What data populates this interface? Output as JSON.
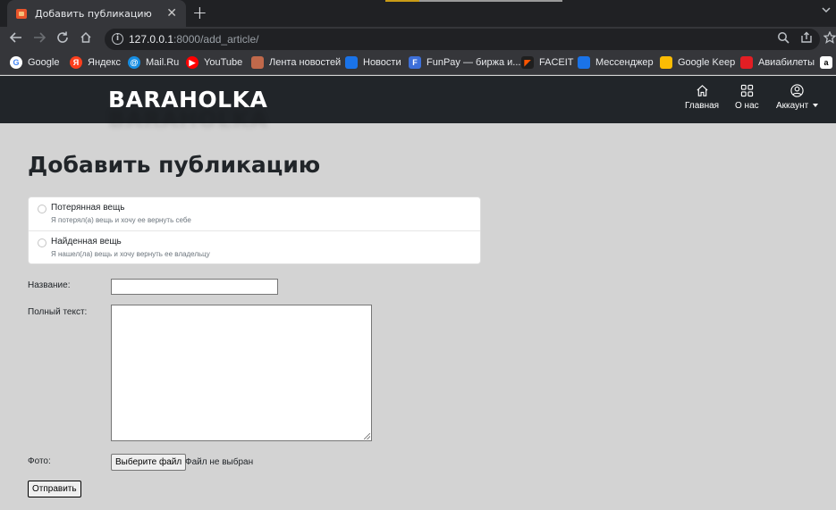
{
  "browser": {
    "tab": {
      "title": "Добавить публикацию",
      "close_glyph": "✕"
    },
    "new_tab_glyph": "+",
    "url": {
      "host": "127.0.0.1",
      "path": ":8000/add_article/"
    },
    "bookmarks": [
      {
        "label": "Google",
        "icon": "google-icon",
        "color": "#4285f4"
      },
      {
        "label": "Яндекс",
        "icon": "yandex-icon",
        "color": "#fc3f1d"
      },
      {
        "label": "Mail.Ru",
        "icon": "mailru-icon",
        "color": "#168de2"
      },
      {
        "label": "YouTube",
        "icon": "youtube-icon",
        "color": "#ff0000"
      },
      {
        "label": "Лента новостей",
        "icon": "news-feed-icon",
        "color": "#c0694b"
      },
      {
        "label": "Новости",
        "icon": "news-icon",
        "color": "#1a73e8"
      },
      {
        "label": "FunPay — биржа и...",
        "icon": "funpay-icon",
        "color": "#3d6fd8"
      },
      {
        "label": "FACEIT",
        "icon": "faceit-icon",
        "color": "#ff5500"
      },
      {
        "label": "Мессенджер",
        "icon": "messenger-icon",
        "color": "#1a73e8"
      },
      {
        "label": "Google Keep",
        "icon": "keep-icon",
        "color": "#fbbc04"
      },
      {
        "label": "Авиабилеты",
        "icon": "avia-icon",
        "color": "#e31e24"
      }
    ]
  },
  "site": {
    "logo": "BARAHOLKA",
    "nav": {
      "home": "Главная",
      "about": "О нас",
      "account": "Аккаунт"
    }
  },
  "form": {
    "title": "Добавить публикацию",
    "type_options": [
      {
        "label": "Потерянная вещь",
        "help": "Я потерял(а) вещь и хочу ее вернуть себе"
      },
      {
        "label": "Найденная вещь",
        "help": "Я нашел(ла) вещь и хочу вернуть ее владельцу"
      }
    ],
    "name_label": "Название:",
    "name_value": "",
    "text_label": "Полный текст:",
    "text_value": "",
    "photo_label": "Фото:",
    "file_button": "Выберите файл",
    "file_status": "Файл не выбран",
    "submit": "Отправить"
  },
  "colors": {
    "navbar": "#212529",
    "page_bg": "#d3d3d3",
    "chrome_dark": "#202124",
    "chrome_toolbar": "#35363a"
  }
}
